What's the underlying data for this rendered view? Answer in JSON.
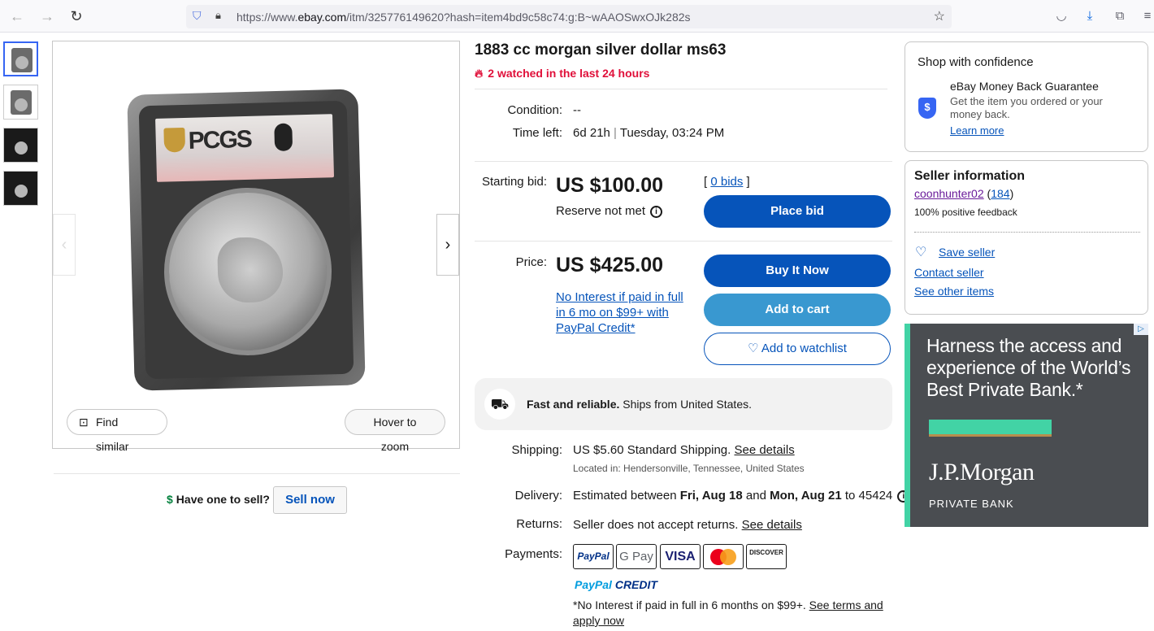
{
  "browser": {
    "url_prefix": "https://www.",
    "url_host": "ebay.com",
    "url_path": "/itm/325776149620?hash=item4bd9c58c74:g:B~wAAOSwxOJk282s"
  },
  "gallery": {
    "find_similar": "Find similar",
    "hover_zoom": "Hover to zoom"
  },
  "sell": {
    "question": "Have one to sell?",
    "button": "Sell now"
  },
  "item": {
    "title": "1883 cc morgan silver dollar ms63",
    "watched": "2 watched in the last 24 hours",
    "condition_label": "Condition:",
    "condition_value": "--",
    "time_left_label": "Time left:",
    "time_left_value": "6d 21h",
    "time_left_end": "Tuesday, 03:24 PM",
    "starting_bid_label": "Starting bid:",
    "starting_bid_value": "US $100.00",
    "reserve": "Reserve not met",
    "bids_open": "[ ",
    "bids_link": "0 bids",
    "bids_close": " ]",
    "place_bid": "Place bid",
    "price_label": "Price:",
    "price_value": "US $425.00",
    "credit_offer": "No Interest if paid in full in 6 mo on $99+ with PayPal Credit*",
    "buy_now": "Buy It Now",
    "add_cart": "Add to cart",
    "add_watch": "Add to watchlist"
  },
  "shipping_box": {
    "bold": "Fast and reliable.",
    "text": " Ships from United States."
  },
  "details": {
    "shipping_label": "Shipping:",
    "shipping_price": "US $5.60",
    "shipping_method": " Standard Shipping. ",
    "see_details": "See details",
    "located": "Located in: Hendersonville, Tennessee, United States",
    "delivery_label": "Delivery:",
    "delivery_pre": "Estimated between ",
    "delivery_from": "Fri, Aug 18",
    "delivery_and": " and ",
    "delivery_to": "Mon, Aug 21",
    "delivery_zip": " to 45424",
    "returns_label": "Returns:",
    "returns_value": "Seller does not accept returns. ",
    "returns_link": "See details",
    "payments_label": "Payments:",
    "payment_methods": [
      "PayPal",
      "G Pay",
      "VISA",
      "",
      "DISCOVER"
    ],
    "ppcredit_a": "PayPal",
    "ppcredit_b": " CREDIT",
    "terms_text": "*No Interest if paid in full in 6 months on $99+. ",
    "terms_link": "See terms and apply now"
  },
  "confidence": {
    "heading": "Shop with confidence",
    "guarantee_title": "eBay Money Back Guarantee",
    "guarantee_text": "Get the item you ordered or your money back.",
    "learn_more": "Learn more"
  },
  "seller": {
    "heading": "Seller information",
    "name": "coonhunter02",
    "feedback_count": "184",
    "feedback_pct": "100% positive feedback",
    "save": "Save seller",
    "contact": "Contact seller",
    "other": "See other items"
  },
  "ad": {
    "headline": "Harness the access and experience of the World’s Best Private Bank.*",
    "brand": "J.P.Morgan",
    "sub": "PRIVATE BANK"
  }
}
